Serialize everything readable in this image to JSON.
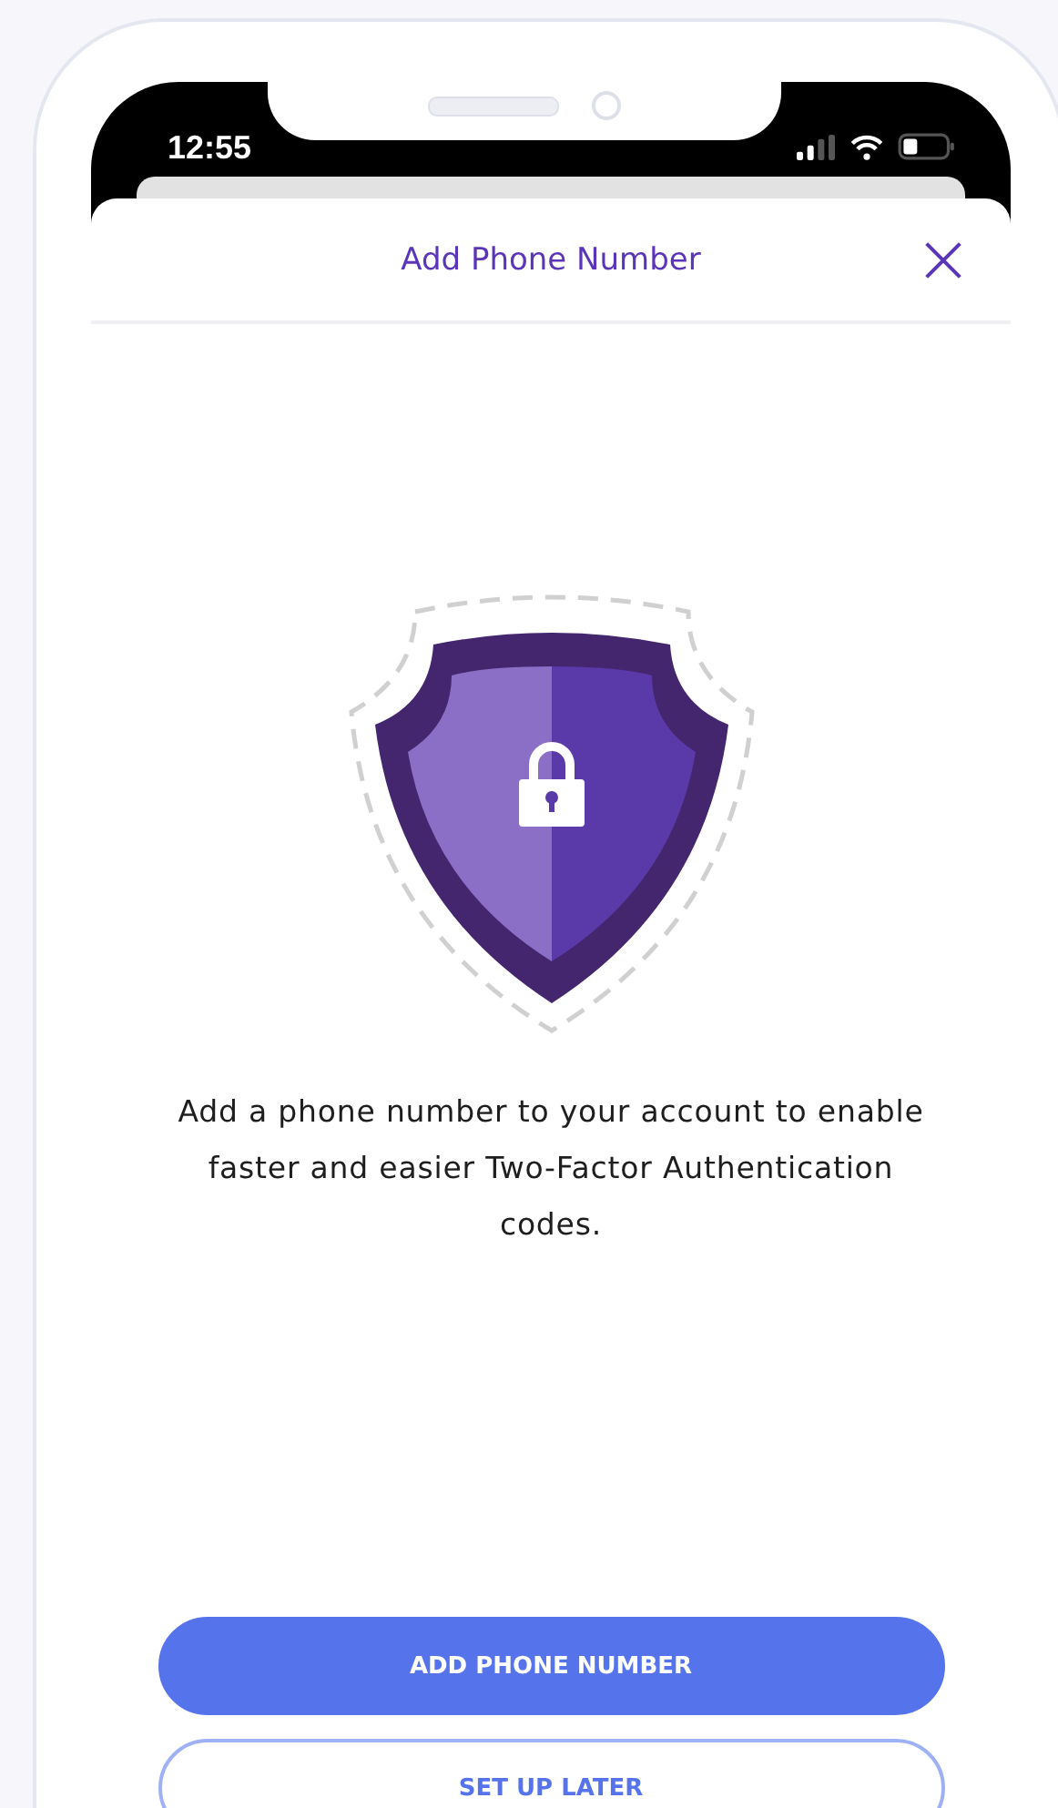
{
  "status_bar": {
    "time": "12:55"
  },
  "modal": {
    "title": "Add Phone Number",
    "description": "Add a phone number to your account to enable faster and easier Two-Factor Authentication codes."
  },
  "buttons": [
    {
      "label": "ADD PHONE NUMBER",
      "kind": "primary"
    },
    {
      "label": "SET UP LATER",
      "kind": "secondary"
    }
  ]
}
